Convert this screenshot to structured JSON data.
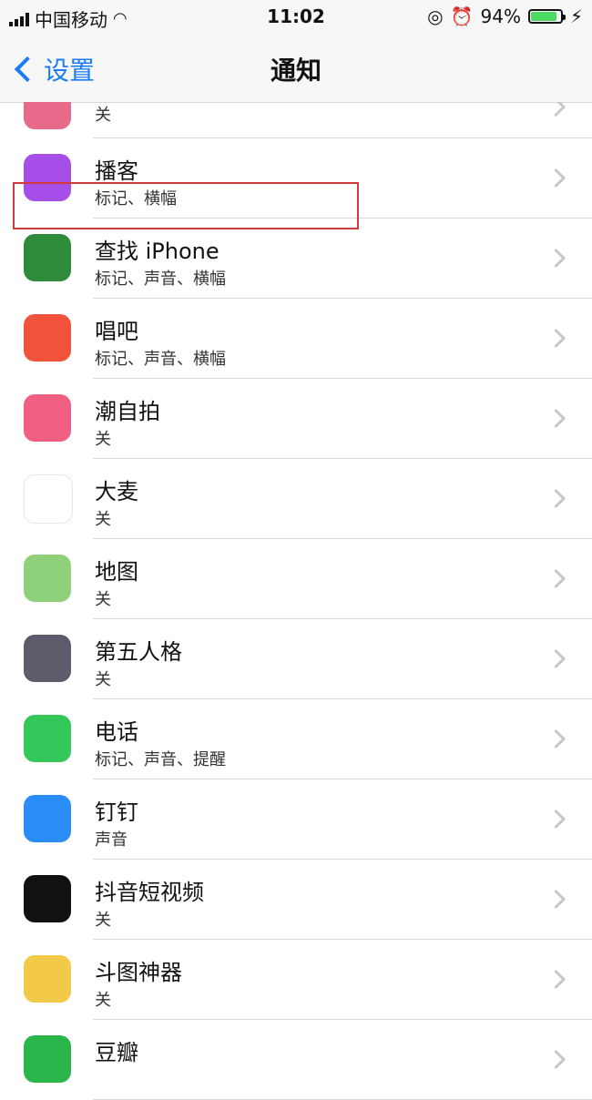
{
  "status_bar": {
    "carrier": "中国移动",
    "time": "11:02",
    "battery": "94%",
    "battery_level": 0.94
  },
  "nav": {
    "back_label": "设置",
    "title": "通知"
  },
  "top_partial_row": {
    "subtitle": "关"
  },
  "items": [
    {
      "title": "播客",
      "subtitle": "标记、横幅",
      "icon": "podcasts-icon",
      "color": "#a64ee8"
    },
    {
      "title": "查找 iPhone",
      "subtitle": "标记、声音、横幅",
      "icon": "find-iphone-icon",
      "color": "#2e8b3a"
    },
    {
      "title": "唱吧",
      "subtitle": "标记、声音、横幅",
      "icon": "changba-icon",
      "color": "#f0523c"
    },
    {
      "title": "潮自拍",
      "subtitle": "关",
      "icon": "chaozipai-icon",
      "color": "#f05f82"
    },
    {
      "title": "大麦",
      "subtitle": "关",
      "icon": "damai-icon",
      "color": "#ffffff"
    },
    {
      "title": "地图",
      "subtitle": "关",
      "icon": "maps-icon",
      "color": "#8fd07a"
    },
    {
      "title": "第五人格",
      "subtitle": "关",
      "icon": "identity-v-icon",
      "color": "#5c5c6a"
    },
    {
      "title": "电话",
      "subtitle": "标记、声音、提醒",
      "icon": "phone-icon",
      "color": "#34c759"
    },
    {
      "title": "钉钉",
      "subtitle": "声音",
      "icon": "dingtalk-icon",
      "color": "#2a8cf5"
    },
    {
      "title": "抖音短视频",
      "subtitle": "关",
      "icon": "douyin-icon",
      "color": "#111111"
    },
    {
      "title": "斗图神器",
      "subtitle": "关",
      "icon": "doutu-icon",
      "color": "#f3c94a"
    },
    {
      "title": "豆瓣",
      "subtitle": "",
      "icon": "douban-icon",
      "color": "#2ab64a"
    }
  ]
}
